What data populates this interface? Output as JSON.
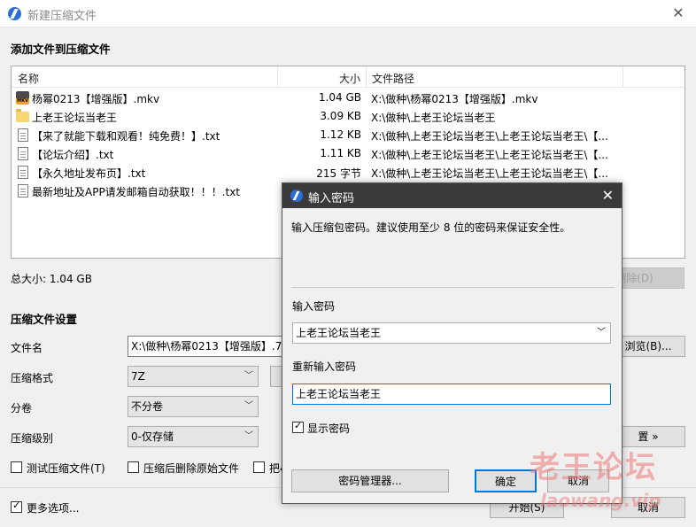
{
  "window": {
    "title": "新建压缩文件"
  },
  "add_section": {
    "heading": "添加文件到压缩文件"
  },
  "file_list": {
    "columns": [
      "名称",
      "大小",
      "文件路径"
    ],
    "rows": [
      {
        "name": "杨幂0213【增强版】.mkv",
        "size": "1.04 GB",
        "path": "X:\\做种\\杨幂0213【增强版】.mkv",
        "icon": "video-file-icon"
      },
      {
        "name": "上老王论坛当老王",
        "size": "3.09 KB",
        "path": "X:\\做种\\上老王论坛当老王",
        "icon": "folder-icon"
      },
      {
        "name": "【来了就能下载和观看！纯免费！】.txt",
        "size": "1.12 KB",
        "path": "X:\\做种\\上老王论坛当老王\\上老王论坛当老王\\【...",
        "icon": "text-file-icon"
      },
      {
        "name": "【论坛介绍】.txt",
        "size": "1.11 KB",
        "path": "X:\\做种\\上老王论坛当老王\\上老王论坛当老王\\【...",
        "icon": "text-file-icon"
      },
      {
        "name": "【永久地址发布页】.txt",
        "size": "215 字节",
        "path": "X:\\做种\\上老王论坛当老王\\上老王论坛当老王\\【...",
        "icon": "text-file-icon"
      },
      {
        "name": "最新地址及APP请发邮箱自动获取！！！.txt",
        "size": "",
        "path": "",
        "icon": "text-file-icon"
      }
    ]
  },
  "total_size": "总大小: 1.04 GB",
  "delete_button": "删除(D)",
  "settings": {
    "heading": "压缩文件设置",
    "filename_label": "文件名",
    "filename_value": "X:\\做种\\杨幂0213【增强版】.7z",
    "browse_button": "浏览(B)...",
    "format_label": "压缩格式",
    "format_value": "7Z",
    "split_label": "分卷",
    "split_value": "不分卷",
    "level_label": "压缩级别",
    "level_value": "0-仅存储",
    "advanced_button": "置 »",
    "test_checkbox": "测试压缩文件(T)",
    "delete_after_checkbox": "压缩后删除原始文件",
    "partial_checkbox": "把4"
  },
  "more_options": "更多选项...",
  "start_button": "开始(S)",
  "cancel_main_button": "取消",
  "password_dialog": {
    "title": "输入密码",
    "description": "输入压缩包密码。建议使用至少 8 位的密码来保证安全性。",
    "password_label": "输入密码",
    "password_value": "上老王论坛当老王",
    "confirm_label": "重新输入密码",
    "confirm_value": "上老王论坛当老王",
    "show_password_label": "显示密码",
    "show_password_checked": true,
    "manager_button": "密码管理器...",
    "ok_button": "确定",
    "cancel_button": "取消"
  },
  "watermark": {
    "line1": "老王论坛",
    "line2": "laowang.vip"
  },
  "colors": {
    "accent": "#2b6fd6",
    "dialog_title_bg": "#3a3a3a",
    "focus_border": "#0078d7"
  }
}
